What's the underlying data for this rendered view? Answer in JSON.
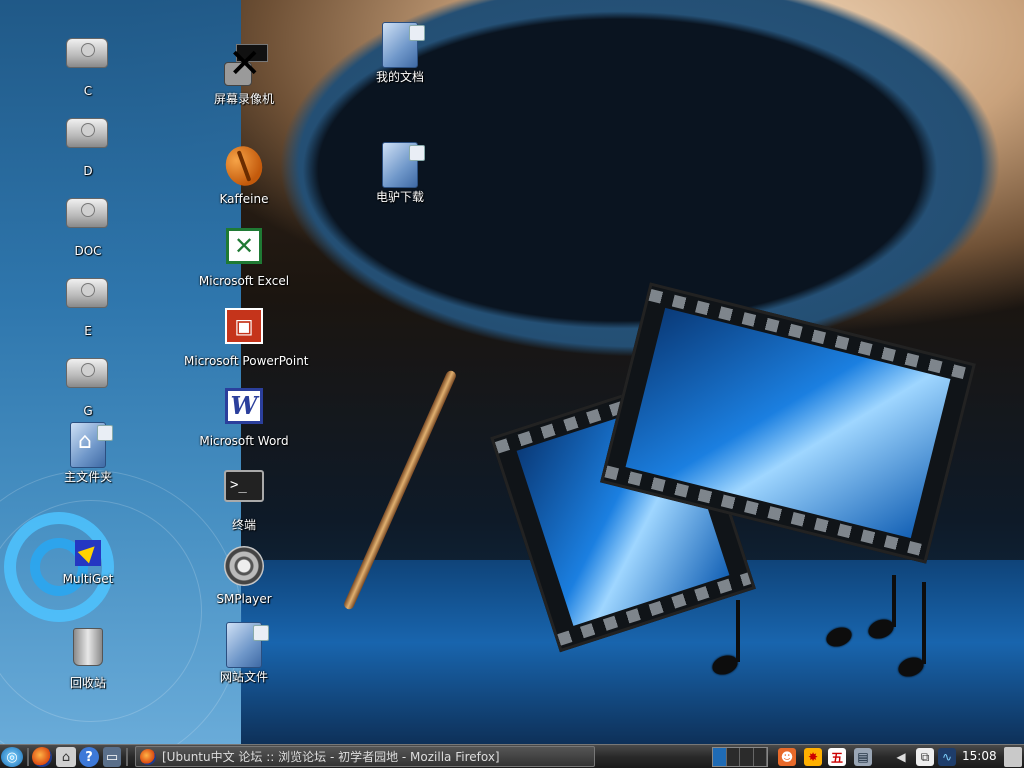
{
  "desktop": {
    "icons": {
      "drive_c": "C",
      "drive_d": "D",
      "drive_doc": "DOC",
      "drive_e": "E",
      "drive_g": "G",
      "home": "主文件夹",
      "multiget": "MultiGet",
      "trash": "回收站",
      "recorder": "屏幕录像机",
      "kaffeine": "Kaffeine",
      "excel": "Microsoft Excel",
      "powerpoint": "Microsoft PowerPoint",
      "word": "Microsoft Word",
      "terminal": "终端",
      "smplayer": "SMPlayer",
      "website": "网站文件",
      "my_docs": "我的文档",
      "emule": "电驴下载"
    }
  },
  "taskbar": {
    "window_title": "[Ubuntu中文 论坛 :: 浏览论坛 - 初学者园地 - Mozilla Firefox]",
    "clock": "15:08",
    "pager": {
      "workspaces": 4,
      "active": 1
    },
    "icons": {
      "menu": "ubuntu-menu-icon",
      "launchers": [
        "firefox-icon",
        "home-icon",
        "help-icon",
        "show-desktop-icon"
      ],
      "tray": [
        "user-icon",
        "alert-icon",
        "input-method-icon",
        "network-icon",
        "volume-icon",
        "clipboard-icon",
        "system-monitor-icon"
      ]
    }
  }
}
